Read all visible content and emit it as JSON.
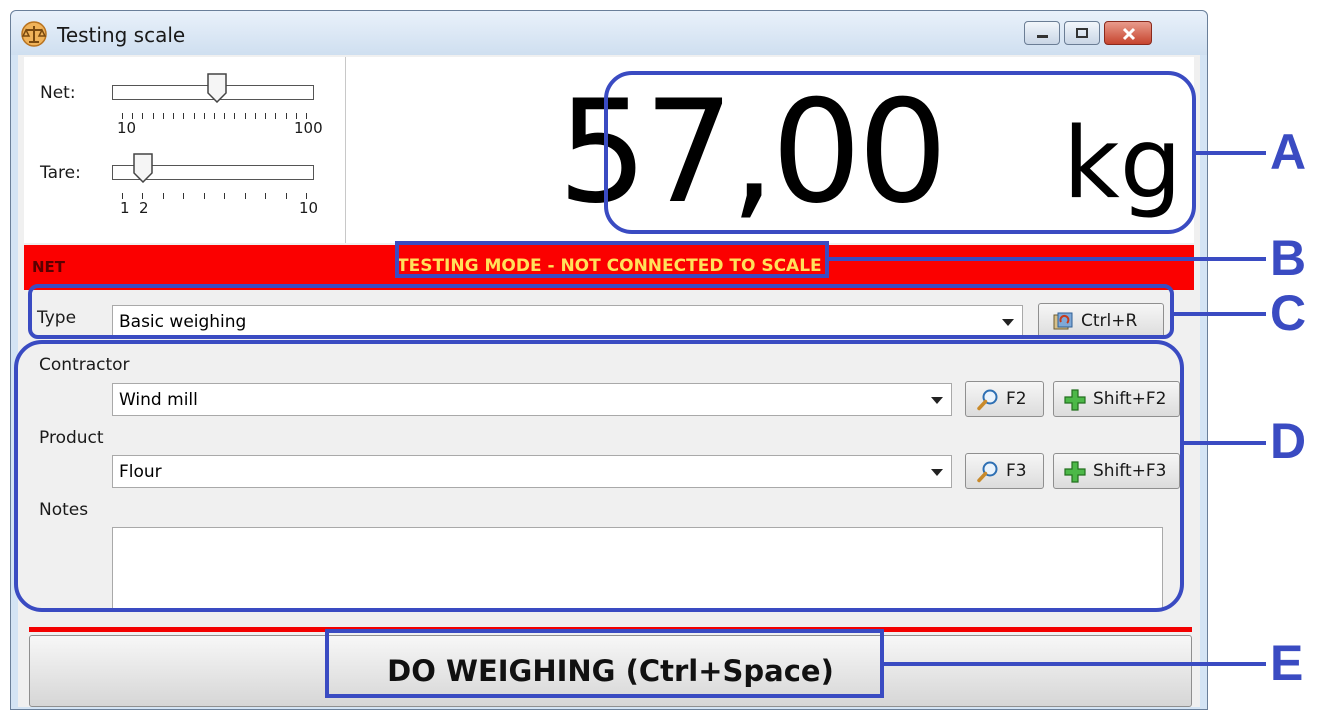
{
  "window": {
    "title": "Testing scale"
  },
  "sliders": {
    "net": {
      "label": "Net:",
      "min_label": "10",
      "max_label": "100",
      "value": 57
    },
    "tare": {
      "label": "Tare:",
      "min_labels": [
        "1",
        "2"
      ],
      "max_label": "10",
      "value": 2
    }
  },
  "display": {
    "weight": "57,00",
    "unit": "kg"
  },
  "status": {
    "mode": "NET",
    "message": "TESTING MODE - NOT CONNECTED TO SCALE"
  },
  "type": {
    "label": "Type",
    "value": "Basic weighing",
    "button": "Ctrl+R"
  },
  "contractor": {
    "label": "Contractor",
    "value": "Wind mill",
    "search_button": "F2",
    "add_button": "Shift+F2"
  },
  "product": {
    "label": "Product",
    "value": "Flour",
    "search_button": "F3",
    "add_button": "Shift+F3"
  },
  "notes": {
    "label": "Notes",
    "value": ""
  },
  "action": {
    "label": "DO WEIGHING (Ctrl+Space)"
  },
  "annotations": [
    "A",
    "B",
    "C",
    "D",
    "E"
  ],
  "colors": {
    "status_bar": "#fb0000",
    "status_text": "#ffe15a",
    "annotation": "#3a4bc2"
  }
}
